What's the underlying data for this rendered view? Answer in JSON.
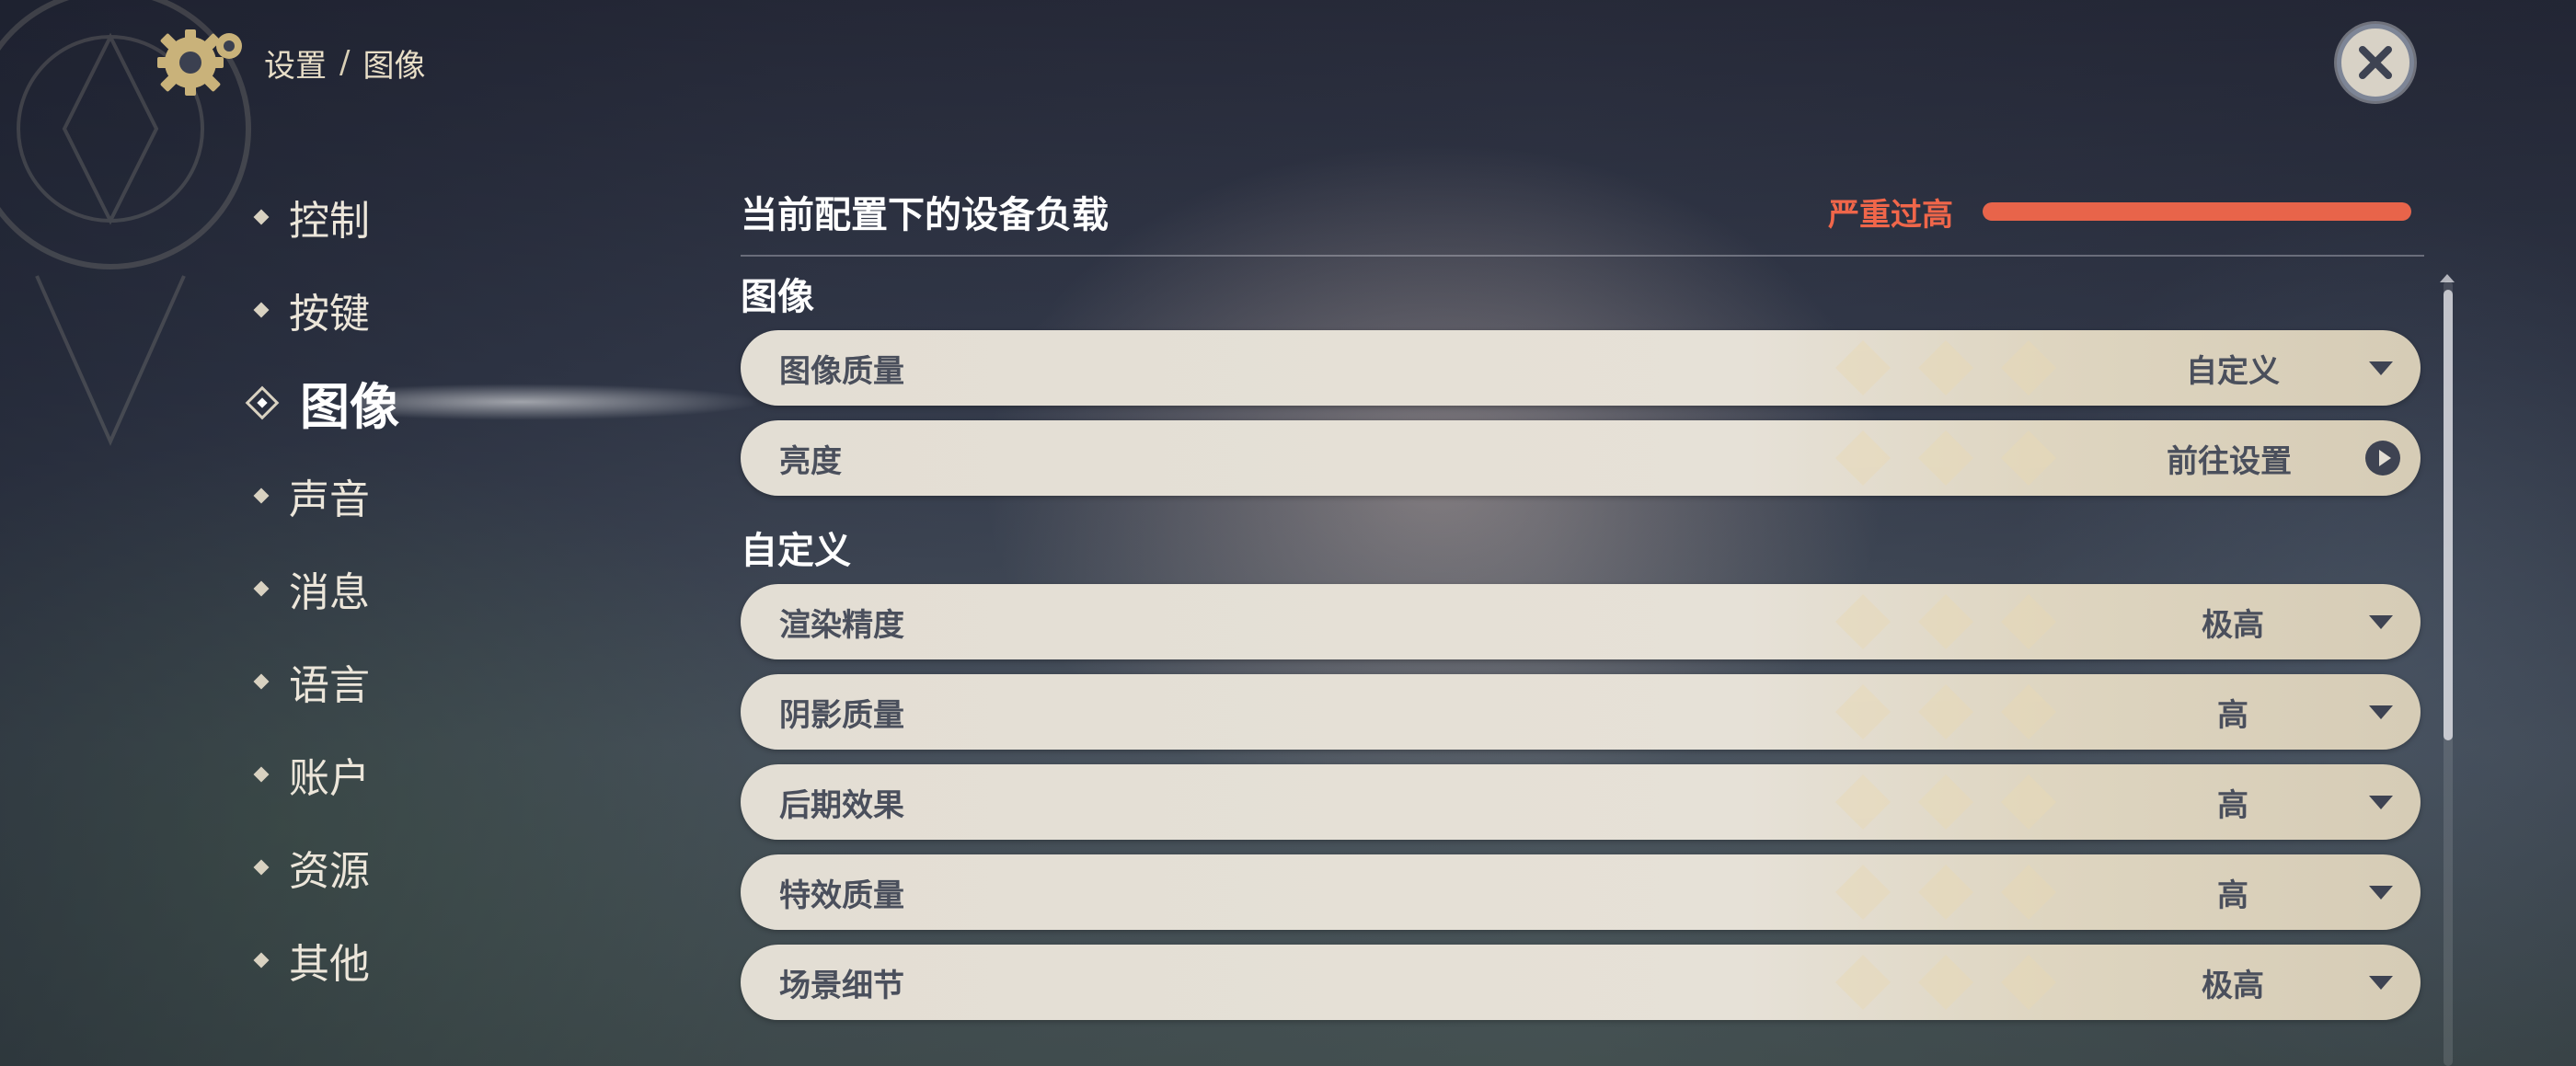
{
  "header": {
    "breadcrumb": [
      "设置",
      "图像"
    ],
    "separator": "/"
  },
  "sidebar": {
    "items": [
      {
        "label": "控制"
      },
      {
        "label": "按键"
      },
      {
        "label": "图像",
        "active": true
      },
      {
        "label": "声音"
      },
      {
        "label": "消息"
      },
      {
        "label": "语言"
      },
      {
        "label": "账户"
      },
      {
        "label": "资源"
      },
      {
        "label": "其他"
      }
    ]
  },
  "device_load": {
    "title": "当前配置下的设备负载",
    "status": "严重过高",
    "level_percent": 100,
    "color": "#e8644a"
  },
  "sections": {
    "image": {
      "title": "图像",
      "rows": [
        {
          "label": "图像质量",
          "value": "自定义",
          "control": "dropdown"
        },
        {
          "label": "亮度",
          "value": "前往设置",
          "control": "link"
        }
      ]
    },
    "custom": {
      "title": "自定义",
      "rows": [
        {
          "label": "渲染精度",
          "value": "极高",
          "control": "dropdown"
        },
        {
          "label": "阴影质量",
          "value": "高",
          "control": "dropdown"
        },
        {
          "label": "后期效果",
          "value": "高",
          "control": "dropdown"
        },
        {
          "label": "特效质量",
          "value": "高",
          "control": "dropdown"
        },
        {
          "label": "场景细节",
          "value": "极高",
          "control": "dropdown"
        }
      ]
    }
  },
  "icons": {
    "settings": "gear-icon",
    "close": "close-icon",
    "dropdown": "chevron-down-icon",
    "go": "arrow-right-circle-icon"
  },
  "colors": {
    "accent_gold": "#c9b27a",
    "row_bg": "#e3ded4",
    "row_text": "#4a4f5c"
  }
}
